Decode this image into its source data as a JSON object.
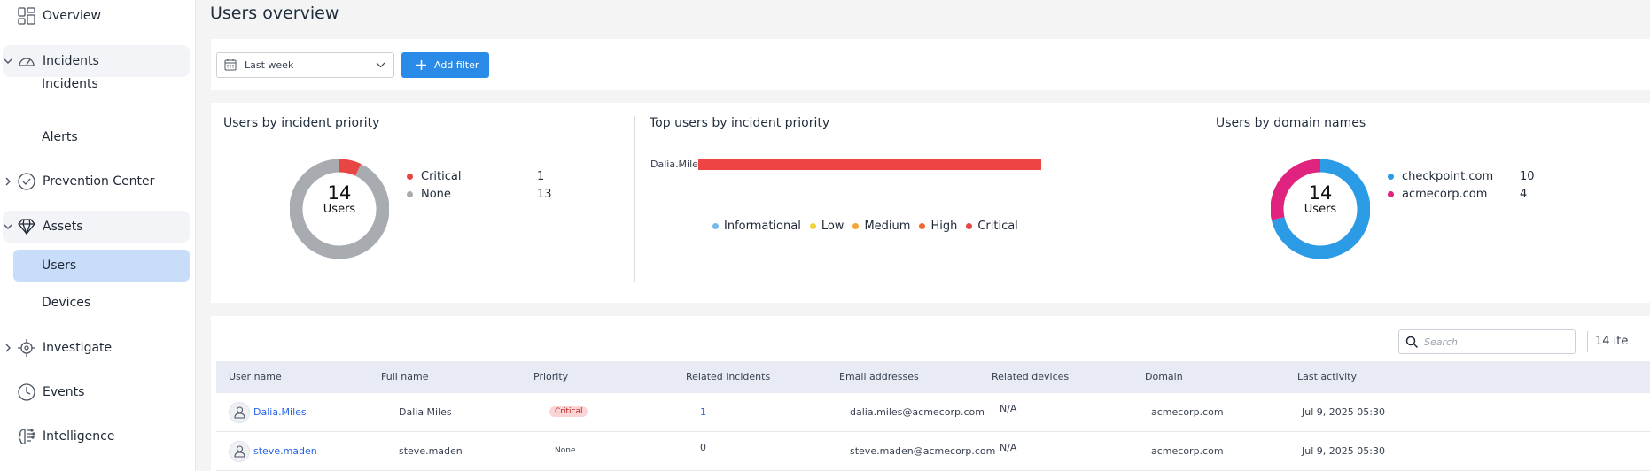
{
  "sidebar": {
    "items": [
      {
        "label": "Overview"
      },
      {
        "label": "Incidents"
      },
      {
        "label": "Incidents"
      },
      {
        "label": "Alerts"
      },
      {
        "label": "Prevention Center"
      },
      {
        "label": "Assets"
      },
      {
        "label": "Users"
      },
      {
        "label": "Devices"
      },
      {
        "label": "Investigate"
      },
      {
        "label": "Events"
      },
      {
        "label": "Intelligence"
      }
    ]
  },
  "page": {
    "title": "Users overview"
  },
  "filters": {
    "date_range": "Last week",
    "add_filter_label": "Add filter"
  },
  "charts": {
    "priority": {
      "title": "Users by incident priority",
      "total": "14",
      "center_label": "Users",
      "legend": [
        {
          "label": "Critical",
          "value": "1",
          "color": "#e84545"
        },
        {
          "label": "None",
          "value": "13",
          "color": "#a8abb0"
        }
      ]
    },
    "top_users": {
      "title": "Top users by incident priority",
      "legend": [
        {
          "label": "Informational",
          "color": "#7ab8e8"
        },
        {
          "label": "Low",
          "color": "#f2d33a"
        },
        {
          "label": "Medium",
          "color": "#f4a23a"
        },
        {
          "label": "High",
          "color": "#ef6a2c"
        },
        {
          "label": "Critical",
          "color": "#e84545"
        }
      ]
    },
    "domains": {
      "title": "Users by domain names",
      "total": "14",
      "center_label": "Users",
      "legend": [
        {
          "label": "checkpoint.com",
          "value": "10",
          "color": "#2b9be6"
        },
        {
          "label": "acmecorp.com",
          "value": "4",
          "color": "#e0237f"
        }
      ]
    }
  },
  "chart_data": [
    {
      "type": "pie",
      "title": "Users by incident priority",
      "categories": [
        "Critical",
        "None"
      ],
      "values": [
        1,
        13
      ]
    },
    {
      "type": "bar",
      "title": "Top users by incident priority",
      "categories": [
        "Dalia.Miles"
      ],
      "series": [
        {
          "name": "Critical",
          "values": [
            1
          ]
        }
      ]
    },
    {
      "type": "pie",
      "title": "Users by domain names",
      "categories": [
        "checkpoint.com",
        "acmecorp.com"
      ],
      "values": [
        10,
        4
      ]
    }
  ],
  "table": {
    "search_placeholder": "Search",
    "items_count": "14 ite",
    "columns": [
      "User name",
      "Full name",
      "Priority",
      "Related incidents",
      "Email addresses",
      "Related devices",
      "Domain",
      "Last activity"
    ],
    "rows": [
      {
        "user_name": "Dalia.Miles",
        "full_name": "Dalia Miles",
        "priority": "Critical",
        "related_incidents": "1",
        "email": "dalia.miles@acmecorp.com",
        "devices": "N/A",
        "domain": "acmecorp.com",
        "last_activity": "Jul 9, 2025 05:30"
      },
      {
        "user_name": "steve.maden",
        "full_name": "steve.maden",
        "priority": "None",
        "related_incidents": "0",
        "email": "steve.maden@acmecorp.com",
        "devices": "N/A",
        "domain": "acmecorp.com",
        "last_activity": "Jul 9, 2025 05:30"
      }
    ]
  }
}
